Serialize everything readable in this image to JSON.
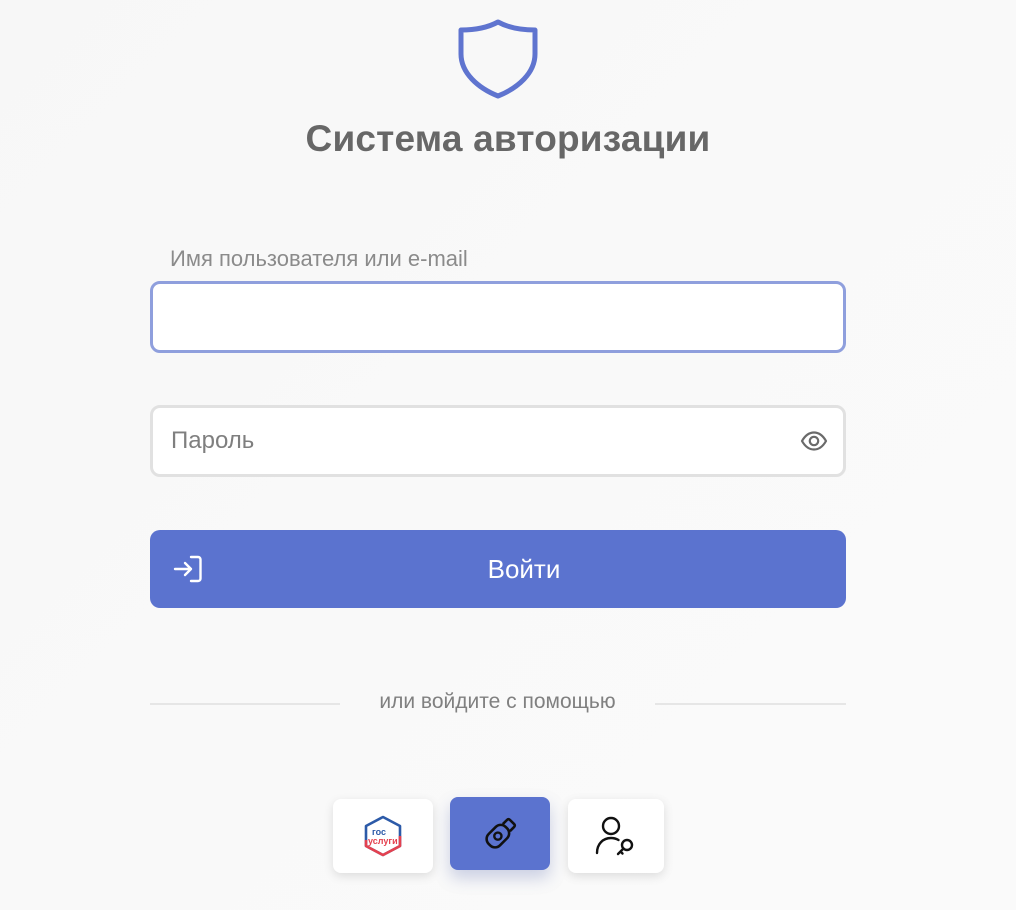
{
  "header": {
    "logo_icon": "shield-icon",
    "title": "Система авторизации"
  },
  "form": {
    "username": {
      "label": "Имя пользователя или e-mail",
      "value": "",
      "placeholder": ""
    },
    "password": {
      "placeholder": "Пароль",
      "value": "",
      "toggle_icon": "eye-icon"
    },
    "submit": {
      "label": "Войти",
      "icon": "login-arrow-icon"
    }
  },
  "alternative": {
    "divider_text": "или войдите с помощью",
    "providers": [
      {
        "id": "gosuslugi",
        "icon": "gosuslugi-logo-icon",
        "logo_text_top": "гос",
        "logo_text_bottom": "услуги"
      },
      {
        "id": "usb-token",
        "icon": "usb-token-icon",
        "active": true
      },
      {
        "id": "user-key",
        "icon": "user-key-icon"
      }
    ]
  },
  "colors": {
    "accent": "#5b73cf",
    "focus_border": "#8f9fdd",
    "title": "#676767",
    "gos_blue": "#2c5aa8",
    "gos_red": "#e4414f"
  }
}
